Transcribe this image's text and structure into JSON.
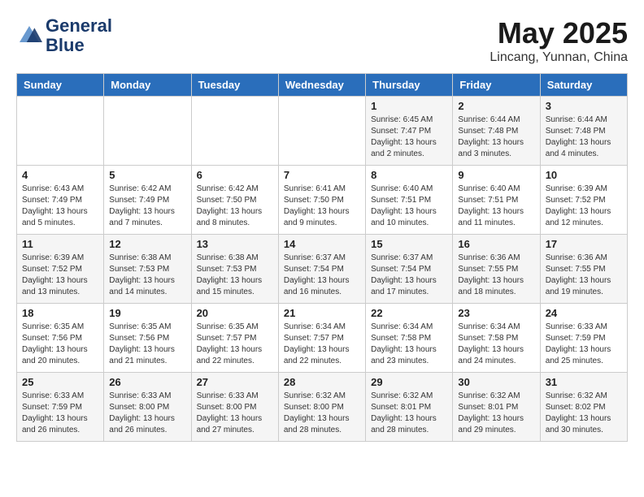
{
  "header": {
    "logo_line1": "General",
    "logo_line2": "Blue",
    "month": "May 2025",
    "location": "Lincang, Yunnan, China"
  },
  "weekdays": [
    "Sunday",
    "Monday",
    "Tuesday",
    "Wednesday",
    "Thursday",
    "Friday",
    "Saturday"
  ],
  "weeks": [
    [
      {
        "day": "",
        "info": ""
      },
      {
        "day": "",
        "info": ""
      },
      {
        "day": "",
        "info": ""
      },
      {
        "day": "",
        "info": ""
      },
      {
        "day": "1",
        "info": "Sunrise: 6:45 AM\nSunset: 7:47 PM\nDaylight: 13 hours\nand 2 minutes."
      },
      {
        "day": "2",
        "info": "Sunrise: 6:44 AM\nSunset: 7:48 PM\nDaylight: 13 hours\nand 3 minutes."
      },
      {
        "day": "3",
        "info": "Sunrise: 6:44 AM\nSunset: 7:48 PM\nDaylight: 13 hours\nand 4 minutes."
      }
    ],
    [
      {
        "day": "4",
        "info": "Sunrise: 6:43 AM\nSunset: 7:49 PM\nDaylight: 13 hours\nand 5 minutes."
      },
      {
        "day": "5",
        "info": "Sunrise: 6:42 AM\nSunset: 7:49 PM\nDaylight: 13 hours\nand 7 minutes."
      },
      {
        "day": "6",
        "info": "Sunrise: 6:42 AM\nSunset: 7:50 PM\nDaylight: 13 hours\nand 8 minutes."
      },
      {
        "day": "7",
        "info": "Sunrise: 6:41 AM\nSunset: 7:50 PM\nDaylight: 13 hours\nand 9 minutes."
      },
      {
        "day": "8",
        "info": "Sunrise: 6:40 AM\nSunset: 7:51 PM\nDaylight: 13 hours\nand 10 minutes."
      },
      {
        "day": "9",
        "info": "Sunrise: 6:40 AM\nSunset: 7:51 PM\nDaylight: 13 hours\nand 11 minutes."
      },
      {
        "day": "10",
        "info": "Sunrise: 6:39 AM\nSunset: 7:52 PM\nDaylight: 13 hours\nand 12 minutes."
      }
    ],
    [
      {
        "day": "11",
        "info": "Sunrise: 6:39 AM\nSunset: 7:52 PM\nDaylight: 13 hours\nand 13 minutes."
      },
      {
        "day": "12",
        "info": "Sunrise: 6:38 AM\nSunset: 7:53 PM\nDaylight: 13 hours\nand 14 minutes."
      },
      {
        "day": "13",
        "info": "Sunrise: 6:38 AM\nSunset: 7:53 PM\nDaylight: 13 hours\nand 15 minutes."
      },
      {
        "day": "14",
        "info": "Sunrise: 6:37 AM\nSunset: 7:54 PM\nDaylight: 13 hours\nand 16 minutes."
      },
      {
        "day": "15",
        "info": "Sunrise: 6:37 AM\nSunset: 7:54 PM\nDaylight: 13 hours\nand 17 minutes."
      },
      {
        "day": "16",
        "info": "Sunrise: 6:36 AM\nSunset: 7:55 PM\nDaylight: 13 hours\nand 18 minutes."
      },
      {
        "day": "17",
        "info": "Sunrise: 6:36 AM\nSunset: 7:55 PM\nDaylight: 13 hours\nand 19 minutes."
      }
    ],
    [
      {
        "day": "18",
        "info": "Sunrise: 6:35 AM\nSunset: 7:56 PM\nDaylight: 13 hours\nand 20 minutes."
      },
      {
        "day": "19",
        "info": "Sunrise: 6:35 AM\nSunset: 7:56 PM\nDaylight: 13 hours\nand 21 minutes."
      },
      {
        "day": "20",
        "info": "Sunrise: 6:35 AM\nSunset: 7:57 PM\nDaylight: 13 hours\nand 22 minutes."
      },
      {
        "day": "21",
        "info": "Sunrise: 6:34 AM\nSunset: 7:57 PM\nDaylight: 13 hours\nand 22 minutes."
      },
      {
        "day": "22",
        "info": "Sunrise: 6:34 AM\nSunset: 7:58 PM\nDaylight: 13 hours\nand 23 minutes."
      },
      {
        "day": "23",
        "info": "Sunrise: 6:34 AM\nSunset: 7:58 PM\nDaylight: 13 hours\nand 24 minutes."
      },
      {
        "day": "24",
        "info": "Sunrise: 6:33 AM\nSunset: 7:59 PM\nDaylight: 13 hours\nand 25 minutes."
      }
    ],
    [
      {
        "day": "25",
        "info": "Sunrise: 6:33 AM\nSunset: 7:59 PM\nDaylight: 13 hours\nand 26 minutes."
      },
      {
        "day": "26",
        "info": "Sunrise: 6:33 AM\nSunset: 8:00 PM\nDaylight: 13 hours\nand 26 minutes."
      },
      {
        "day": "27",
        "info": "Sunrise: 6:33 AM\nSunset: 8:00 PM\nDaylight: 13 hours\nand 27 minutes."
      },
      {
        "day": "28",
        "info": "Sunrise: 6:32 AM\nSunset: 8:00 PM\nDaylight: 13 hours\nand 28 minutes."
      },
      {
        "day": "29",
        "info": "Sunrise: 6:32 AM\nSunset: 8:01 PM\nDaylight: 13 hours\nand 28 minutes."
      },
      {
        "day": "30",
        "info": "Sunrise: 6:32 AM\nSunset: 8:01 PM\nDaylight: 13 hours\nand 29 minutes."
      },
      {
        "day": "31",
        "info": "Sunrise: 6:32 AM\nSunset: 8:02 PM\nDaylight: 13 hours\nand 30 minutes."
      }
    ]
  ]
}
